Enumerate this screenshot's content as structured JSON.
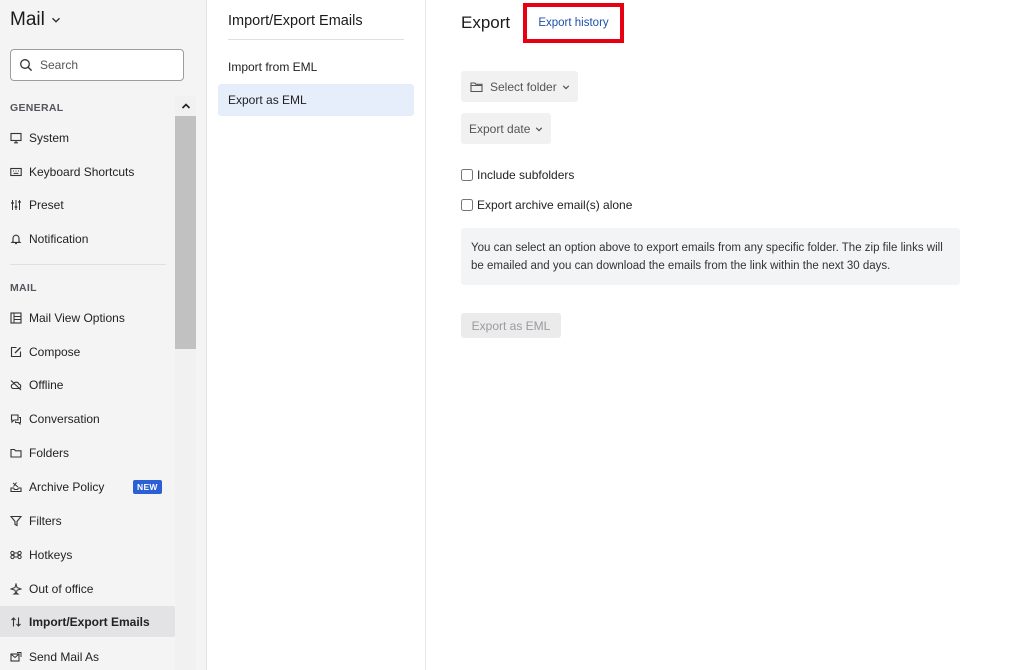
{
  "app": {
    "title": "Mail"
  },
  "search": {
    "placeholder": "Search"
  },
  "sidebar": {
    "general_label": "GENERAL",
    "mail_label": "MAIL",
    "general_items": [
      {
        "label": "System",
        "icon": "monitor-icon"
      },
      {
        "label": "Keyboard Shortcuts",
        "icon": "keyboard-icon"
      },
      {
        "label": "Preset",
        "icon": "sliders-icon"
      },
      {
        "label": "Notification",
        "icon": "bell-icon"
      }
    ],
    "mail_items": [
      {
        "label": "Mail View Options",
        "icon": "layout-icon"
      },
      {
        "label": "Compose",
        "icon": "compose-icon"
      },
      {
        "label": "Offline",
        "icon": "cloud-off-icon"
      },
      {
        "label": "Conversation",
        "icon": "chat-icon"
      },
      {
        "label": "Folders",
        "icon": "folder-icon"
      },
      {
        "label": "Archive Policy",
        "icon": "archive-icon",
        "badge": "NEW"
      },
      {
        "label": "Filters",
        "icon": "filter-icon"
      },
      {
        "label": "Hotkeys",
        "icon": "command-icon"
      },
      {
        "label": "Out of office",
        "icon": "plane-icon"
      },
      {
        "label": "Import/Export Emails",
        "icon": "swap-icon",
        "active": true
      },
      {
        "label": "Send Mail As",
        "icon": "send-as-icon"
      }
    ]
  },
  "mid": {
    "title": "Import/Export Emails",
    "items": [
      {
        "label": "Import from EML"
      },
      {
        "label": "Export as EML",
        "active": true
      }
    ]
  },
  "main": {
    "title": "Export",
    "history_link": "Export history",
    "select_folder": "Select folder",
    "export_date": "Export date",
    "include_subfolders": "Include subfolders",
    "export_archive": "Export archive email(s) alone",
    "info_text": "You can select an option above to export emails from any specific folder. The zip file links will be emailed and you can download the emails from the link within the next 30 days.",
    "export_button": "Export as EML"
  },
  "colors": {
    "accent": "#2a5fd6",
    "highlight_box": "#e60012",
    "link": "#1f4fa8"
  }
}
